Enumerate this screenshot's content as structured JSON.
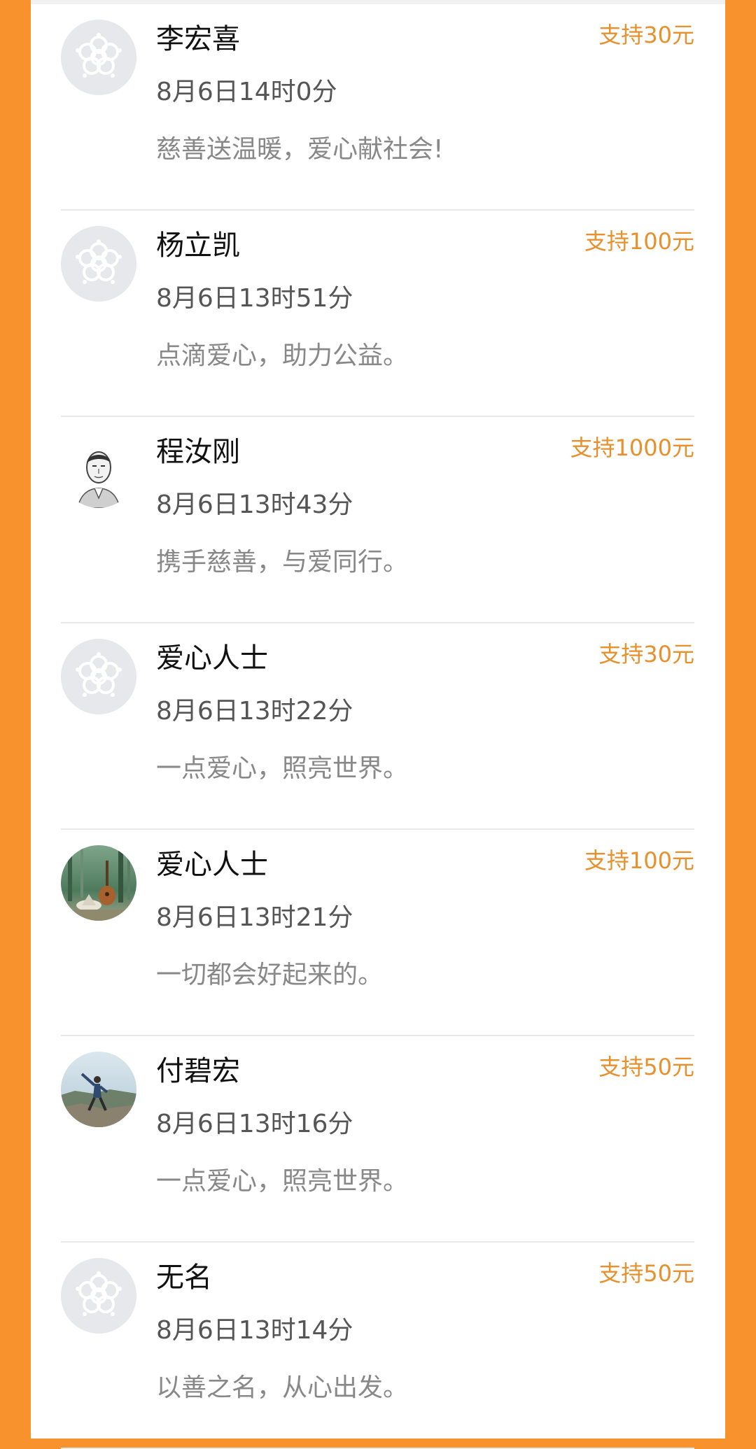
{
  "donations": [
    {
      "name": "李宏喜",
      "time": "8月6日14时0分",
      "message": "慈善送温暖，爱心献社会!",
      "amount": "支持30元",
      "avatar": "default-flower-avatar"
    },
    {
      "name": "杨立凯",
      "time": "8月6日13时51分",
      "message": "点滴爱心，助力公益。",
      "amount": "支持100元",
      "avatar": "default-flower-avatar"
    },
    {
      "name": "程汝刚",
      "time": "8月6日13时43分",
      "message": "携手慈善，与爱同行。",
      "amount": "支持1000元",
      "avatar": "portrait-sketch-avatar"
    },
    {
      "name": "爱心人士",
      "time": "8月6日13时22分",
      "message": "一点爱心，照亮世界。",
      "amount": "支持30元",
      "avatar": "default-flower-avatar"
    },
    {
      "name": "爱心人士",
      "time": "8月6日13时21分",
      "message": "一切都会好起来的。",
      "amount": "支持100元",
      "avatar": "guitar-forest-photo-avatar"
    },
    {
      "name": "付碧宏",
      "time": "8月6日13时16分",
      "message": "一点爱心，照亮世界。",
      "amount": "支持50元",
      "avatar": "person-outdoor-photo-avatar"
    },
    {
      "name": "无名",
      "time": "8月6日13时14分",
      "message": "以善之名，从心出发。",
      "amount": "支持50元",
      "avatar": "default-flower-avatar"
    }
  ],
  "colors": {
    "background": "#F7922D",
    "amount": "#E8902C",
    "name": "#111111",
    "time": "#555555",
    "message": "#888888"
  }
}
